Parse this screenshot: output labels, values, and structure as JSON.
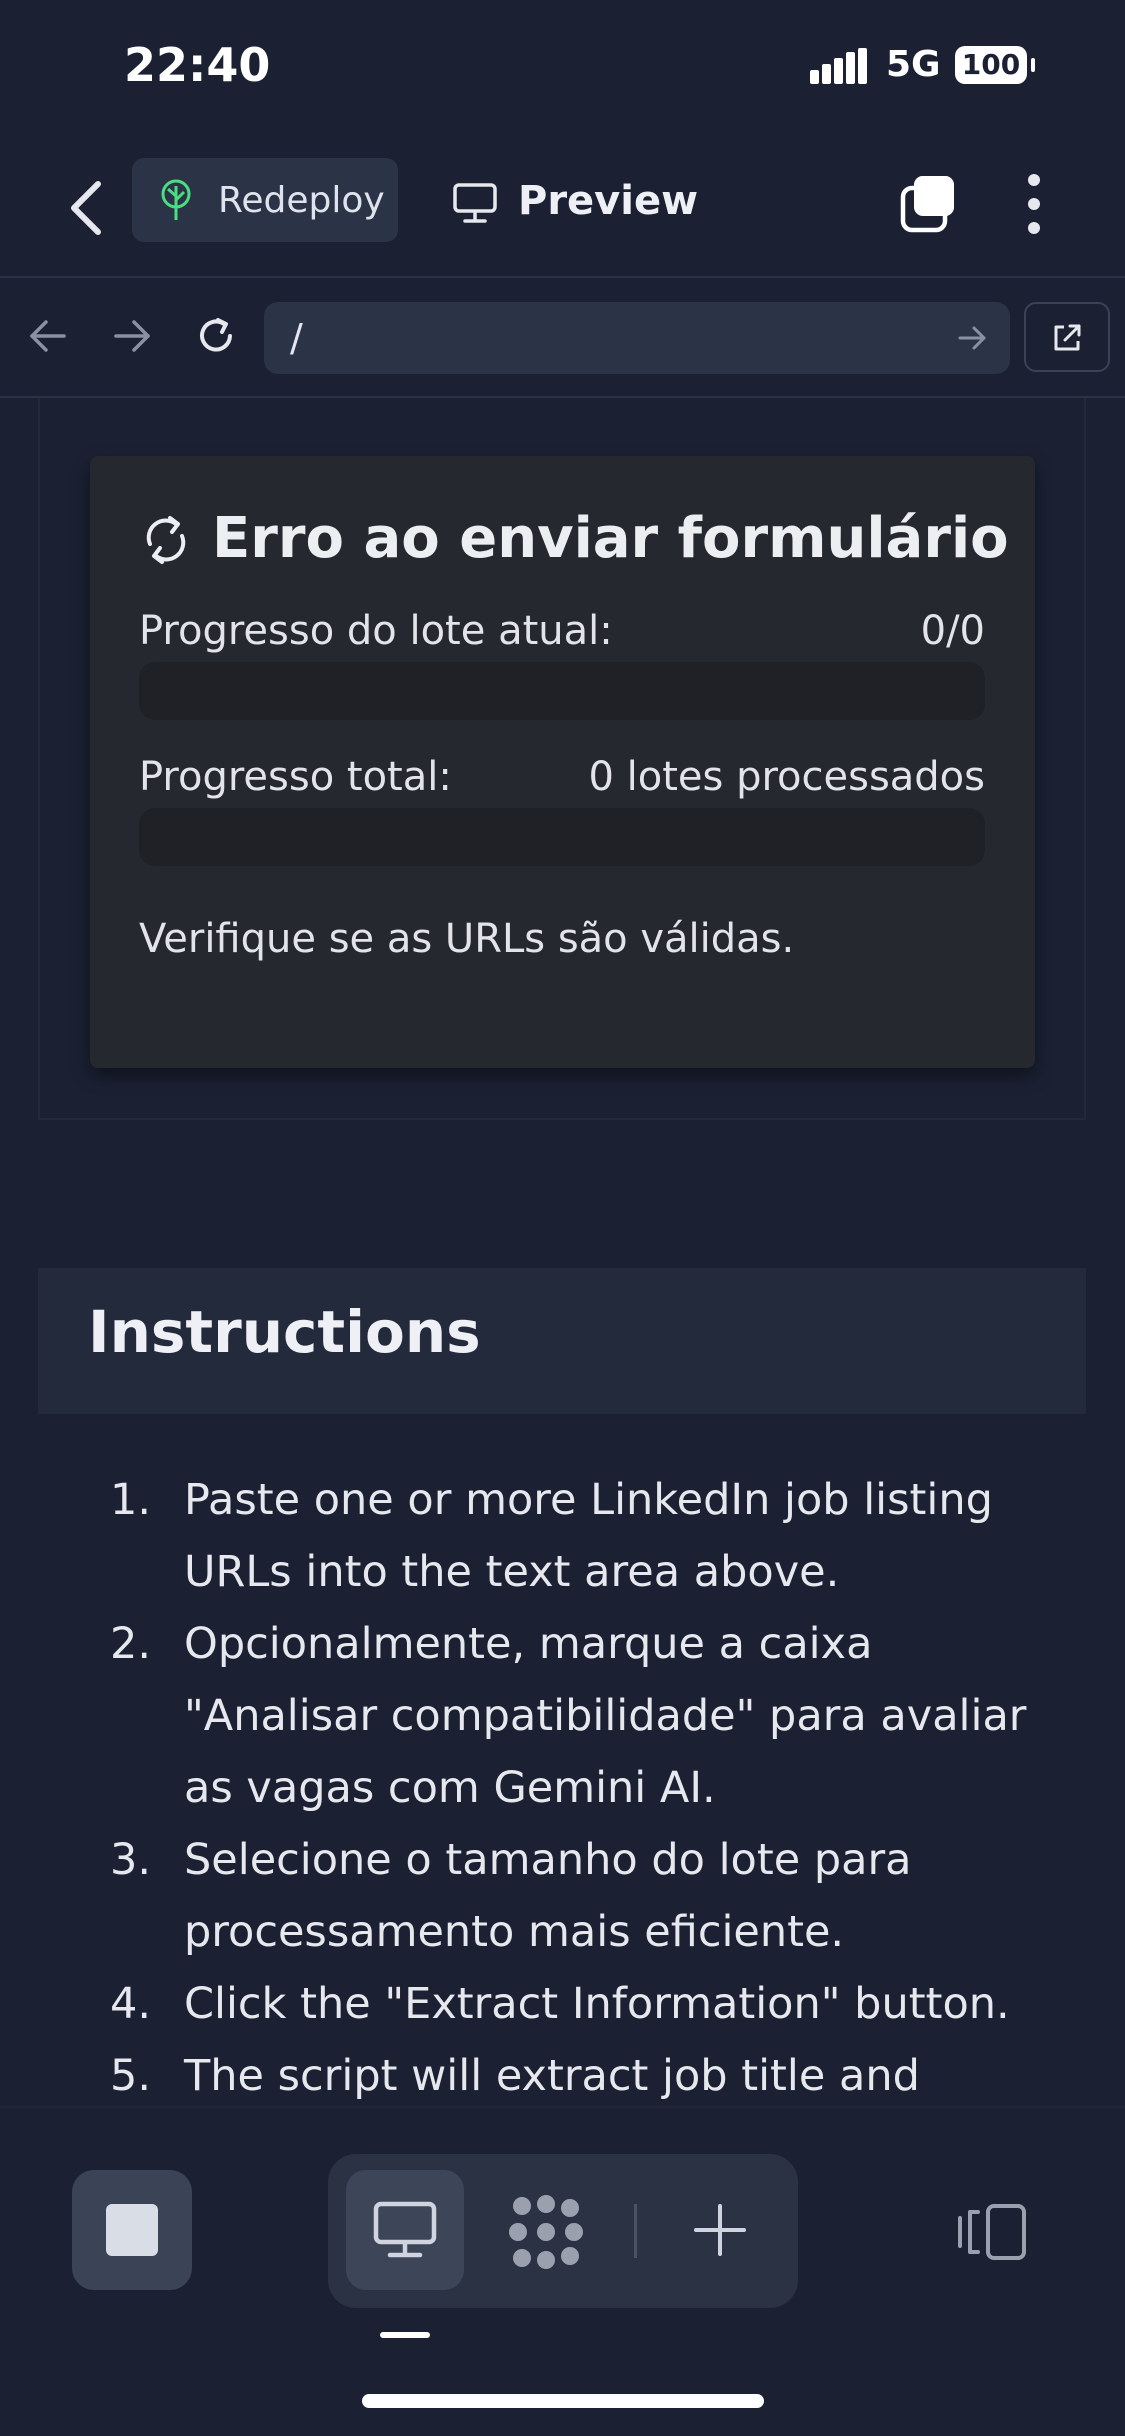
{
  "status_bar": {
    "time": "22:40",
    "network": "5G",
    "battery": "100"
  },
  "toolbar": {
    "redeploy_label": "Redeploy",
    "preview_label": "Preview",
    "redeploy_icon_color": "#4ade80"
  },
  "url_bar": {
    "path": "/"
  },
  "error_card": {
    "title": "Erro ao enviar formulário",
    "batch_progress_label": "Progresso do lote atual:",
    "batch_progress_value": "0/0",
    "batch_progress_fraction": 0,
    "total_progress_label": "Progresso total:",
    "total_progress_value": "0 lotes processados",
    "total_progress_fraction": 0,
    "message": "Verifique se as URLs são válidas."
  },
  "instructions": {
    "title": "Instructions",
    "items": [
      {
        "num": "1.",
        "text": "Paste one or more LinkedIn job listing URLs into the text area above."
      },
      {
        "num": "2.",
        "text": "Opcionalmente, marque a caixa \"Analisar compatibilidade\" para avaliar as vagas com Gemini AI."
      },
      {
        "num": "3.",
        "text": "Selecione o tamanho do lote para processamento mais eficiente."
      },
      {
        "num": "4.",
        "text": "Click the \"Extract Information\" button."
      },
      {
        "num": "5.",
        "text": "The script will extract job title and"
      }
    ]
  },
  "icons": {
    "back": "chevron-left-icon",
    "redeploy": "tree-icon",
    "preview": "monitor-icon",
    "tabs": "tabs-icon",
    "more": "kebab-icon",
    "refresh": "refresh-icon",
    "open_external": "external-link-icon"
  }
}
